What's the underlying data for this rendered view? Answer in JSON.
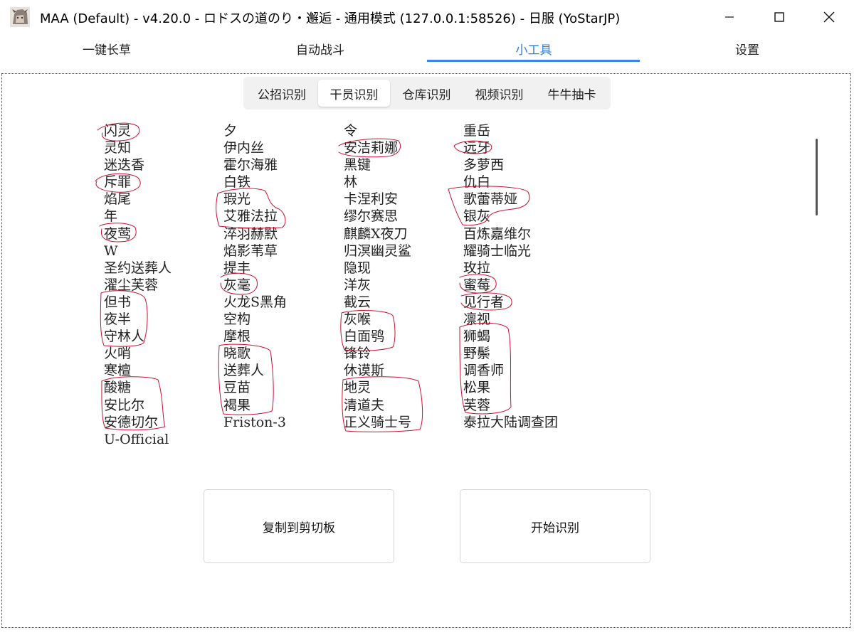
{
  "window": {
    "title": "MAA (Default) - v4.20.0 - ロドスの道のり・邂逅 - 通用模式 (127.0.0.1:58526) - 日服 (YoStarJP)"
  },
  "tabs": [
    {
      "label": "一键长草"
    },
    {
      "label": "自动战斗"
    },
    {
      "label": "小工具"
    },
    {
      "label": "设置"
    }
  ],
  "subtabs": [
    {
      "label": "公招识别"
    },
    {
      "label": "干员识别"
    },
    {
      "label": "仓库识别"
    },
    {
      "label": "视频识别"
    },
    {
      "label": "牛牛抽卡"
    }
  ],
  "operators": {
    "col1": [
      "闪灵",
      "灵知",
      "迷迭香",
      "斥罪",
      "焰尾",
      "年",
      "夜莺",
      "W",
      "圣约送葬人",
      "濯尘芙蓉",
      "但书",
      "夜半",
      "守林人",
      "火哨",
      "寒檀",
      "酸糖",
      "安比尔",
      "安德切尔",
      "U-Official"
    ],
    "col2": [
      "夕",
      "伊内丝",
      "霍尔海雅",
      "白铁",
      "瑕光",
      "艾雅法拉",
      "淬羽赫默",
      "焰影苇草",
      "提丰",
      "灰毫",
      "火龙S黑角",
      "空构",
      "摩根",
      "晓歌",
      "送葬人",
      "豆苗",
      "褐果",
      "Friston-3"
    ],
    "col3": [
      "令",
      "安洁莉娜",
      "黑键",
      "林",
      "卡涅利安",
      "缪尔赛思",
      "麒麟X夜刀",
      "归溟幽灵鲨",
      "隐现",
      "洋灰",
      "截云",
      "灰喉",
      "白面鸮",
      "锋铃",
      "休谟斯",
      "地灵",
      "清道夫",
      "正义骑士号"
    ],
    "col4": [
      "重岳",
      "远牙",
      "多萝西",
      "仇白",
      "歌蕾蒂娅",
      "银灰",
      "百炼嘉维尔",
      "耀骑士临光",
      "玫拉",
      "蜜莓",
      "见行者",
      "凛视",
      "狮蝎",
      "野鬃",
      "调香师",
      "松果",
      "芙蓉",
      "泰拉大陆调查团"
    ]
  },
  "buttons": {
    "copy": "复制到剪切板",
    "start": "开始识别"
  },
  "colors": {
    "accent": "#3a86e8",
    "annotation": "#c8102e"
  }
}
